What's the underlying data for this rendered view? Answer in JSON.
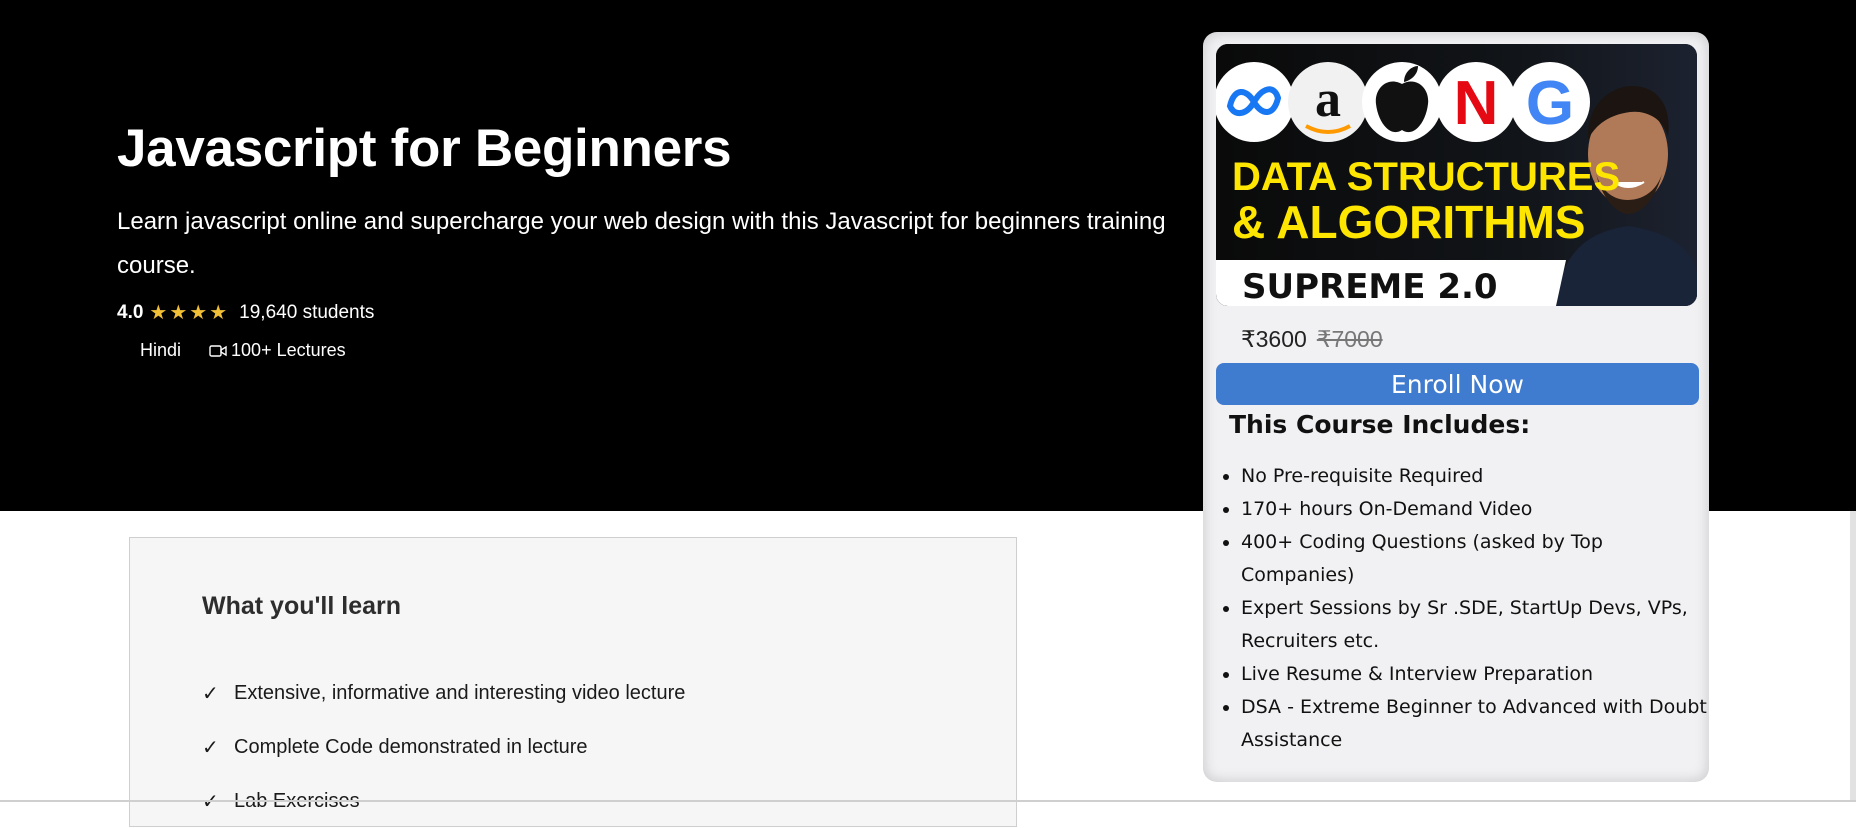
{
  "course": {
    "title": "Javascript for Beginners",
    "subtitle": "Learn javascript online and supercharge your web design with this Javascript for beginners training course.",
    "rating": "4.0",
    "rating_stars": 4,
    "students": "19,640 students",
    "language": "Hindi",
    "lectures": "100+ Lectures"
  },
  "card": {
    "image": {
      "banner_line1": "DATA STRUCTURES",
      "banner_line2": "& ALGORITHMS",
      "banner_line3": "SUPREME 2.0",
      "logos": [
        "meta",
        "amazon",
        "apple",
        "netflix",
        "google"
      ]
    },
    "price_current": "₹3600",
    "price_original": "₹7000",
    "enroll_label": "Enroll Now",
    "includes_title": "This Course Includes:",
    "includes": [
      "No Pre-requisite Required",
      "170+ hours On-Demand Video",
      "400+ Coding Questions (asked by Top Companies)",
      "Expert Sessions by Sr .SDE, StartUp Devs, VPs, Recruiters etc.",
      "Live Resume & Interview Preparation",
      "DSA - Extreme Beginner to Advanced with Doubt Assistance"
    ]
  },
  "learn": {
    "title": "What you'll learn",
    "check_symbol": "✓",
    "items": [
      "Extensive, informative and interesting video lecture",
      "Complete Code demonstrated in lecture",
      "Lab Exercises"
    ]
  },
  "colors": {
    "hero_bg": "#000000",
    "star": "#f2c037",
    "enroll_bg": "#3f7bcf",
    "banner_yellow": "#ffe600"
  }
}
